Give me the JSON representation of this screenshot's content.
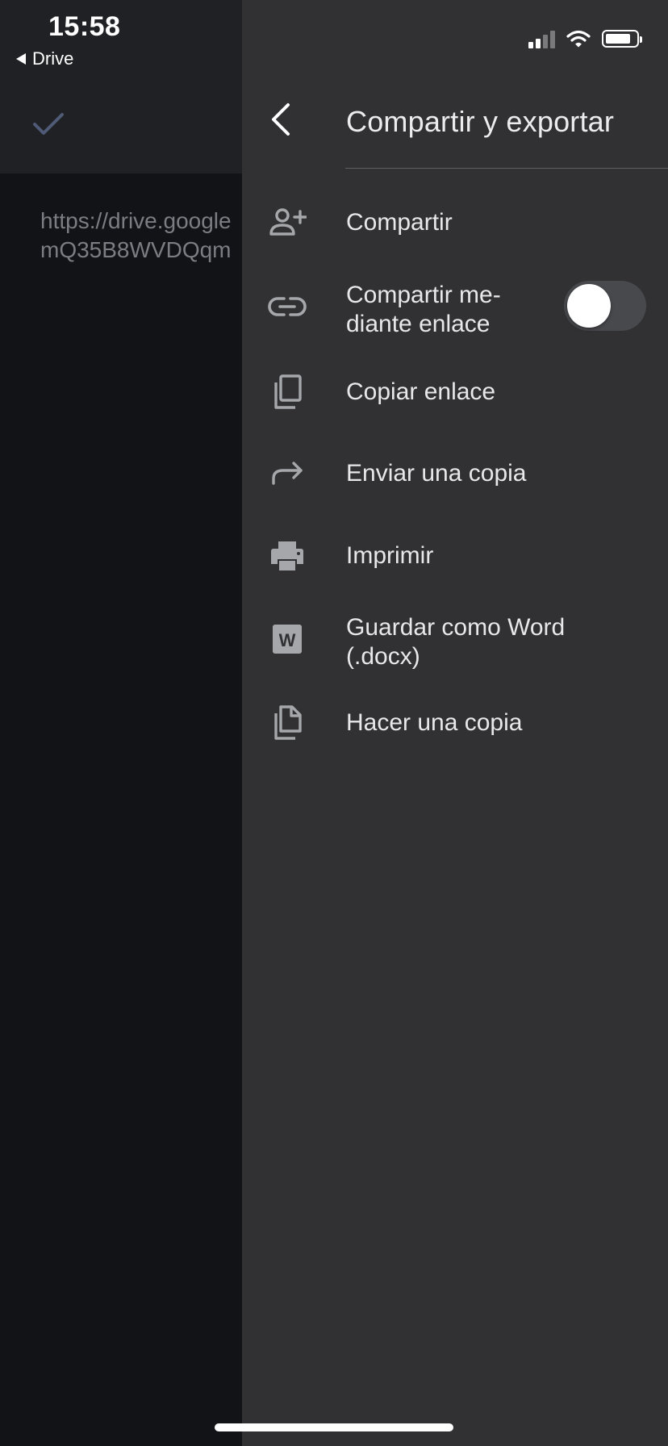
{
  "status_bar": {
    "time": "15:58",
    "back_app_label": "Drive",
    "signal_icon": "cellular-signal-icon",
    "wifi_icon": "wifi-icon",
    "battery_icon": "battery-icon"
  },
  "document": {
    "done_icon": "check-icon",
    "lines": [
      "https://drive.google",
      "mQ35B8WVDQqm"
    ]
  },
  "drawer": {
    "back_icon": "chevron-left-icon",
    "title": "Compartir y exportar",
    "items": [
      {
        "label": "Compartir",
        "icon": "person-add-icon"
      },
      {
        "label": "Compartir me-\ndiante enlace",
        "icon": "link-icon",
        "toggle_on": false
      },
      {
        "label": "Copiar enlace",
        "icon": "copy-icon"
      },
      {
        "label": "Enviar una copia",
        "icon": "forward-arrow-icon"
      },
      {
        "label": "Imprimir",
        "icon": "printer-icon"
      },
      {
        "label": "Guardar como Word\n(.docx)",
        "icon": "word-icon"
      },
      {
        "label": "Hacer una copia",
        "icon": "file-copy-icon"
      }
    ]
  },
  "colors": {
    "drawer_bg": "#313134",
    "background": "#121316",
    "header_bg": "#202124",
    "text": "#e8e8ea",
    "icon": "#a6a7ab",
    "check": "#4f5a77"
  }
}
